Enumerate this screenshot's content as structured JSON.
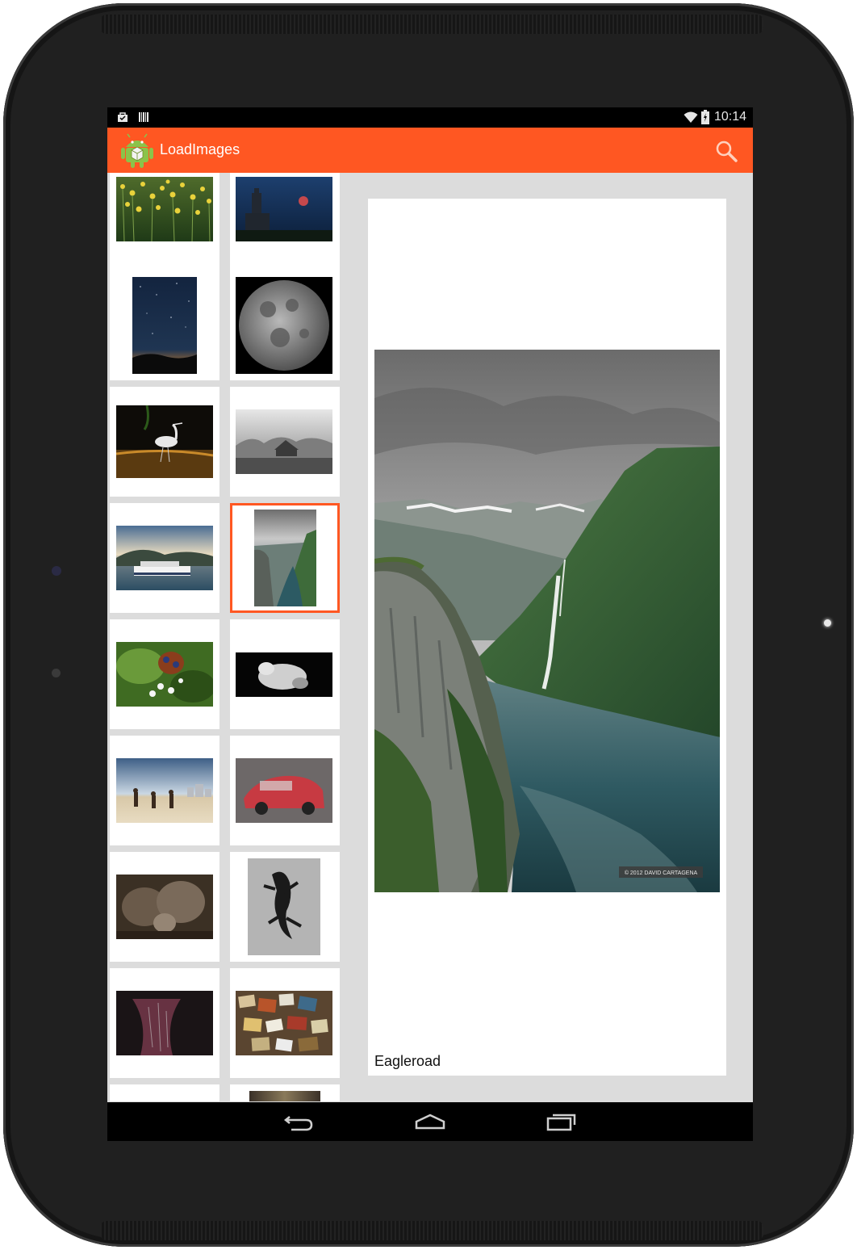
{
  "status_bar": {
    "time": "10:14",
    "left_icons": [
      "shopping-bag-icon",
      "barcode-icon"
    ],
    "right_icons": [
      "wifi-icon",
      "battery-icon"
    ]
  },
  "action_bar": {
    "title": "LoadImages",
    "color": "#ff5722",
    "app_icon": "android-icon",
    "actions": [
      "search-icon"
    ]
  },
  "grid": {
    "thumbnails": [
      {
        "subject": "yellow flowers"
      },
      {
        "subject": "tower and red moon at night"
      },
      {
        "subject": "starry night sky over lake"
      },
      {
        "subject": "full moon"
      },
      {
        "subject": "heron in dark water"
      },
      {
        "subject": "barn in fog"
      },
      {
        "subject": "boat on lake with sunset clouds"
      },
      {
        "subject": "fjord with waterfall",
        "selected": true
      },
      {
        "subject": "butterfly on white blossoms"
      },
      {
        "subject": "polar bear on black"
      },
      {
        "subject": "children playing football on beach"
      },
      {
        "subject": "red car in rain"
      },
      {
        "subject": "elephant family"
      },
      {
        "subject": "gecko shadow on sand"
      },
      {
        "subject": "abstract dark red texture"
      },
      {
        "subject": "wall of postcards and notes"
      }
    ]
  },
  "detail": {
    "title": "Eagleroad",
    "image_subject": "fjord with waterfall and cloudy sky",
    "watermark": "© 2012 DAVID CARTAGENA"
  },
  "nav_bar": {
    "buttons": [
      "back-icon",
      "home-icon",
      "recents-icon"
    ]
  }
}
